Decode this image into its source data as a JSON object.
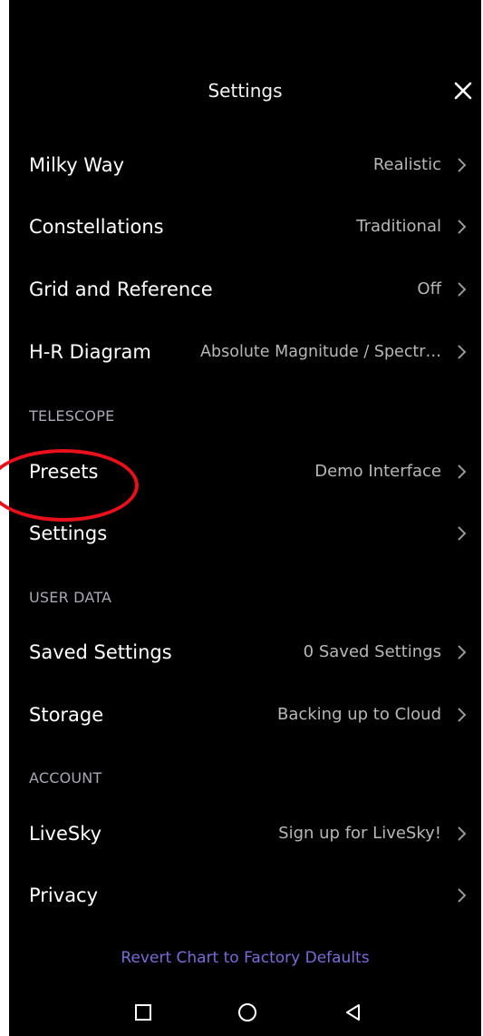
{
  "header": {
    "title": "Settings",
    "close_icon": "close-icon"
  },
  "rows": {
    "milky_way": {
      "label": "Milky Way",
      "value": "Realistic"
    },
    "constellations": {
      "label": "Constellations",
      "value": "Traditional"
    },
    "grid_reference": {
      "label": "Grid and Reference",
      "value": "Off"
    },
    "hr_diagram": {
      "label": "H-R Diagram",
      "value": "Absolute Magnitude / Spectr…"
    },
    "presets": {
      "label": "Presets",
      "value": "Demo Interface"
    },
    "telescope_settings": {
      "label": "Settings",
      "value": ""
    },
    "saved_settings": {
      "label": "Saved Settings",
      "value": "0 Saved Settings"
    },
    "storage": {
      "label": "Storage",
      "value": "Backing up to Cloud"
    },
    "livesky": {
      "label": "LiveSky",
      "value": "Sign up for LiveSky!"
    },
    "privacy": {
      "label": "Privacy",
      "value": ""
    }
  },
  "sections": {
    "telescope": "TELESCOPE",
    "user_data": "USER DATA",
    "account": "ACCOUNT"
  },
  "footer": {
    "revert_label": "Revert Chart to Factory Defaults"
  },
  "navbar": {
    "recents_icon": "square-icon",
    "home_icon": "circle-icon",
    "back_icon": "triangle-back-icon"
  },
  "colors": {
    "background": "#000000",
    "accent": "#7a6bd6",
    "annotation": "#e8101b",
    "secondary_text": "#b7b7b7"
  }
}
